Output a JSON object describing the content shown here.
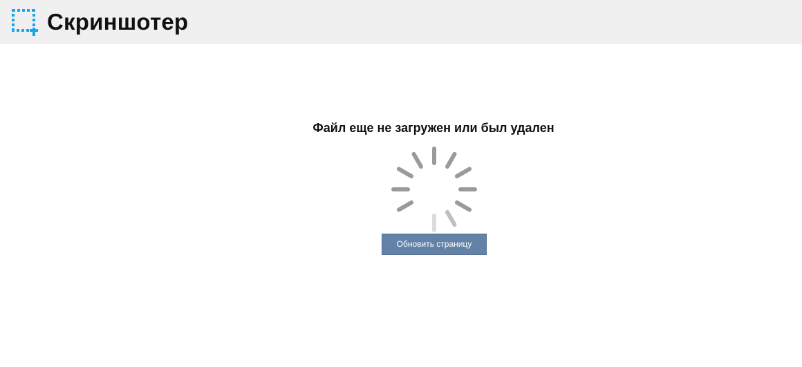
{
  "header": {
    "logo_icon": "screenshot-selection-icon",
    "brand_name": "Скриншотер",
    "accent_color": "#1aa4ee",
    "background": "#f0f0f0"
  },
  "main": {
    "message": "Файл еще не загружен или был удален",
    "spinner_icon": "loading-spinner-icon",
    "refresh_button_label": "Обновить страницу",
    "button_color": "#6282a8"
  }
}
